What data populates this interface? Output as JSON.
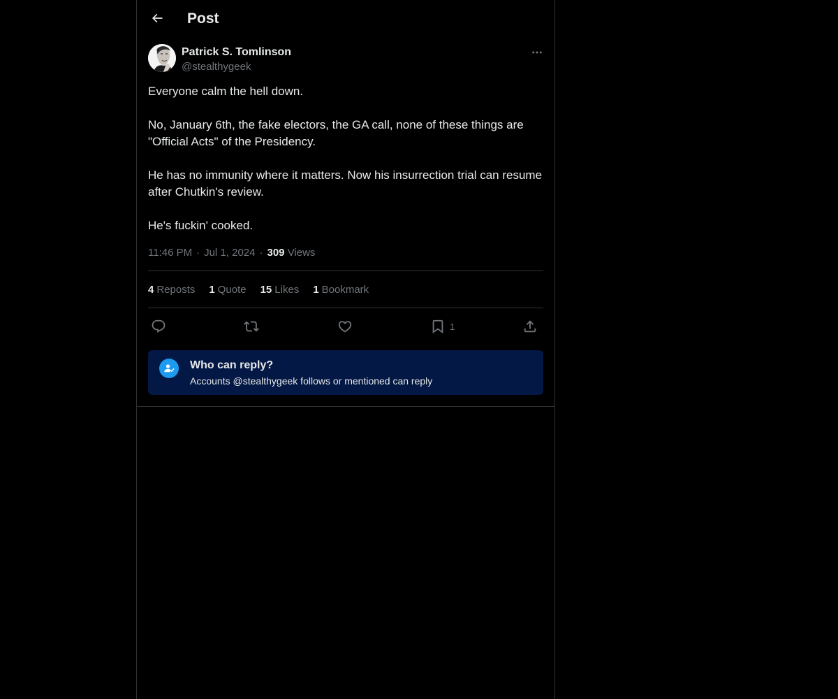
{
  "header": {
    "title": "Post",
    "back_icon": "arrow-left-icon"
  },
  "post": {
    "author": {
      "name": "Patrick S. Tomlinson",
      "handle": "@stealthygeek"
    },
    "paragraphs": [
      "Everyone calm the hell down.",
      "No, January 6th, the fake electors, the GA call, none of these things are \"Official Acts\" of the Presidency.",
      "He has no immunity where it matters. Now his insurrection trial can resume after Chutkin's review.",
      "He's fuckin' cooked."
    ],
    "meta": {
      "time": "11:46 PM",
      "date": "Jul 1, 2024",
      "views_count": "309",
      "views_label": "Views"
    },
    "stats": {
      "reposts_count": "4",
      "reposts_label": "Reposts",
      "quotes_count": "1",
      "quotes_label": "Quote",
      "likes_count": "15",
      "likes_label": "Likes",
      "bookmarks_count": "1",
      "bookmarks_label": "Bookmark"
    },
    "actions": {
      "bookmark_count": "1"
    },
    "reply_restriction": {
      "title": "Who can reply?",
      "subtitle": "Accounts @stealthygeek follows or mentioned can reply"
    }
  },
  "colors": {
    "background": "#000000",
    "border": "#2f3336",
    "text_primary": "#e7e9ea",
    "text_secondary": "#71767b",
    "accent": "#1d9bf0",
    "reply_card_bg": "#031844"
  }
}
